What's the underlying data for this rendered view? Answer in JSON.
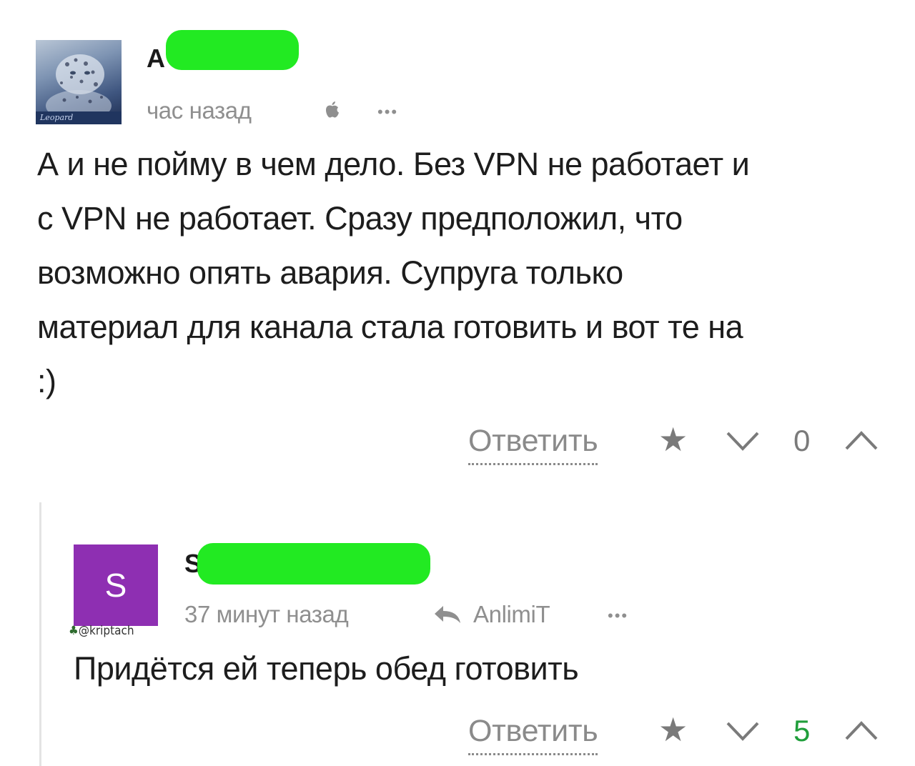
{
  "comment": {
    "author_initial": "A",
    "time": "час назад",
    "text": "А и не пойму в чем дело. Без VPN не работает и\nс VPN не работает. Сразу предположил, что\nвозможно опять авария. Супруга только\nматериал для канала стала готовить и вот те на\n:)",
    "avatar_caption": "Leopard",
    "reply_label": "Ответить",
    "vote_count": "0",
    "icons": [
      "apple-icon",
      "more-icon",
      "star-icon",
      "chevron-down-icon",
      "chevron-up-icon"
    ]
  },
  "reply": {
    "author_initial": "S",
    "avatar_letter": "S",
    "time": "37 минут назад",
    "reply_to": "AnlimiT",
    "text": "Придётся ей теперь обед готовить",
    "reply_label": "Ответить",
    "vote_count": "5",
    "watermark": "@kriptach",
    "icons": [
      "reply-arrow-icon",
      "more-icon",
      "star-icon",
      "chevron-down-icon",
      "chevron-up-icon",
      "tree-icon"
    ]
  },
  "colors": {
    "redaction": "#22ea22",
    "avatar_purple": "#8e2fb2",
    "positive_count": "#1f9e3a",
    "meta_gray": "#8f8f8f"
  }
}
